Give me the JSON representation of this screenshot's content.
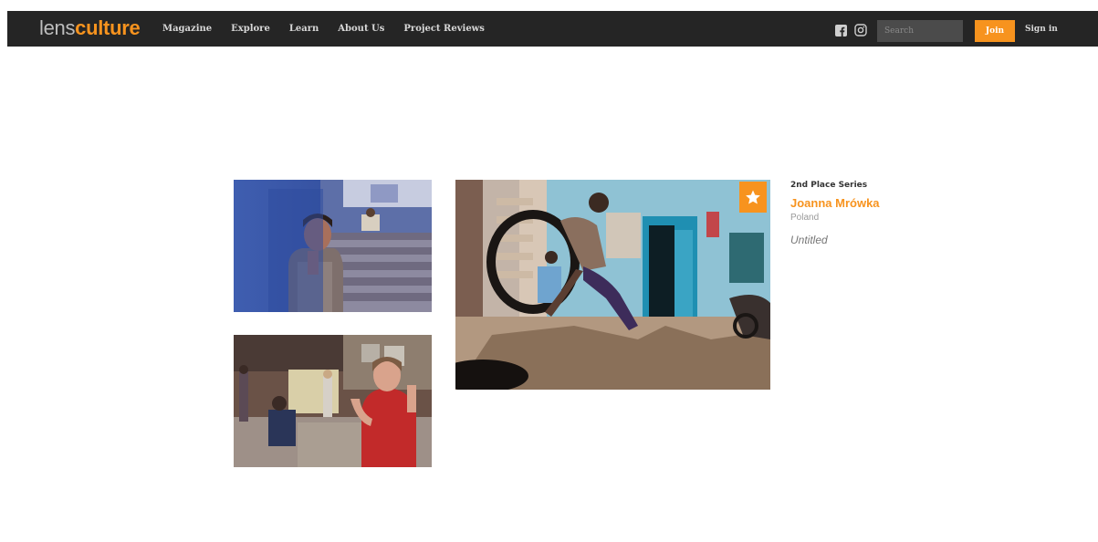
{
  "header": {
    "logo": {
      "part1": "lens",
      "part2": "culture"
    },
    "nav": [
      {
        "label": "Magazine"
      },
      {
        "label": "Explore"
      },
      {
        "label": "Learn"
      },
      {
        "label": "About Us"
      },
      {
        "label": "Project Reviews"
      }
    ],
    "social_icons": [
      "facebook-icon",
      "instagram-icon"
    ],
    "search": {
      "placeholder": "Search",
      "value": ""
    },
    "join_label": "Join",
    "signin_label": "Sign in"
  },
  "series": {
    "award": "2nd Place Series",
    "artist": "Joanna Mrówka",
    "country": "Poland",
    "title": "Untitled"
  },
  "photos": [
    {
      "subject": "boy-on-blue-stairs"
    },
    {
      "subject": "woman-in-red-courtyard"
    },
    {
      "subject": "boy-jumping-tire",
      "featured": true
    }
  ],
  "colors": {
    "accent": "#f7931e",
    "navbar": "#252525",
    "search_bg": "#4b4b4b"
  }
}
